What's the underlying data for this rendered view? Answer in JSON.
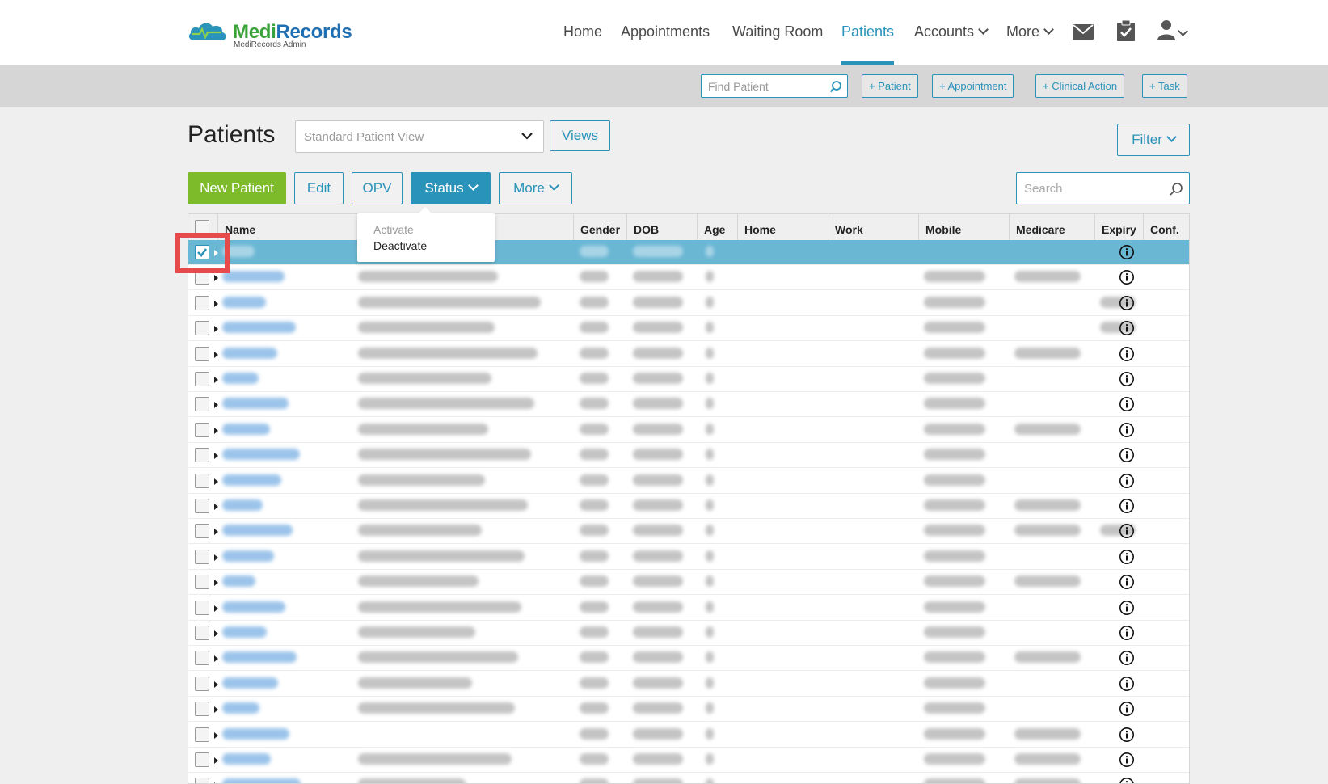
{
  "brand": {
    "name_part1": "Medi",
    "name_part2": "Records",
    "subtitle": "MediRecords Admin"
  },
  "nav": {
    "home": "Home",
    "appointments": "Appointments",
    "waiting_room": "Waiting Room",
    "patients": "Patients",
    "accounts": "Accounts",
    "more": "More",
    "active": "Patients"
  },
  "actionbar": {
    "find_patient_placeholder": "Find Patient",
    "add_patient": "+ Patient",
    "add_appointment": "+ Appointment",
    "add_clinical_action": "+ Clinical Action",
    "add_task": "+ Task"
  },
  "page": {
    "title": "Patients",
    "view_select": "Standard Patient View",
    "views_button": "Views",
    "filter_button": "Filter"
  },
  "toolbar": {
    "new_patient": "New Patient",
    "edit": "Edit",
    "opv": "OPV",
    "status": "Status",
    "more": "More",
    "search_placeholder": "Search"
  },
  "status_menu": {
    "items": [
      {
        "label": "Activate",
        "enabled": false
      },
      {
        "label": "Deactivate",
        "enabled": true
      }
    ]
  },
  "table": {
    "columns": [
      "Name",
      "Gender",
      "DOB",
      "Age",
      "Home",
      "Work",
      "Mobile",
      "Medicare",
      "Expiry",
      "Conf."
    ],
    "selected_row": 0,
    "row_count": 22,
    "note_values": "patient data is blurred in the screenshot"
  },
  "colors": {
    "accent": "#2a93b9",
    "primary_green": "#7dbb2a",
    "selected_row": "#6ab7d4",
    "highlight": "#e64a4a"
  }
}
